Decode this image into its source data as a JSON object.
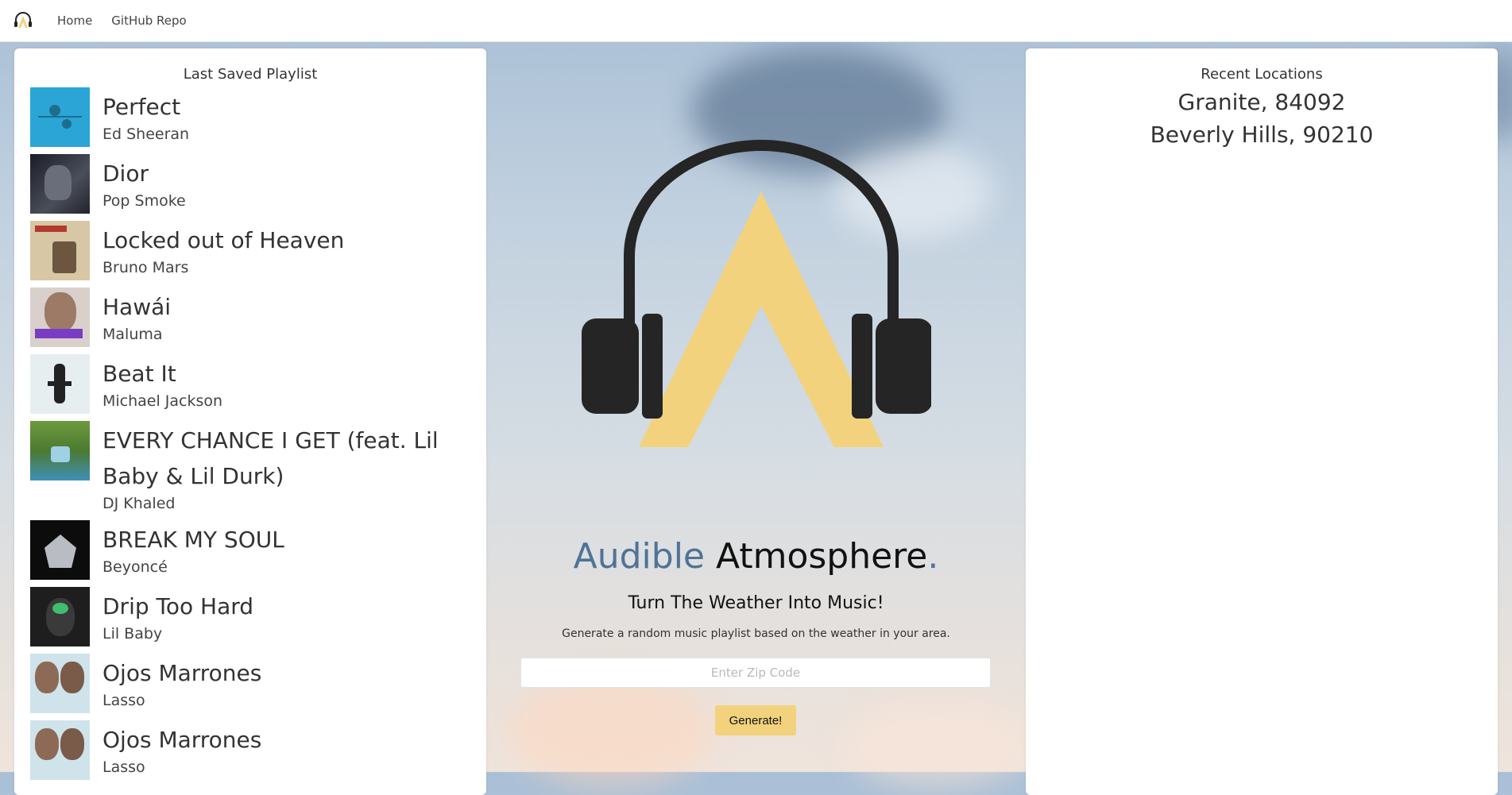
{
  "nav": {
    "logo_icon": "headphones-logo-icon",
    "links": [
      "Home",
      "GitHub Repo"
    ]
  },
  "playlist": {
    "title": "Last Saved Playlist",
    "songs": [
      {
        "title": "Perfect",
        "artist": "Ed Sheeran"
      },
      {
        "title": "Dior",
        "artist": "Pop Smoke"
      },
      {
        "title": "Locked out of Heaven",
        "artist": "Bruno Mars"
      },
      {
        "title": "Hawái",
        "artist": "Maluma"
      },
      {
        "title": "Beat It",
        "artist": "Michael Jackson"
      },
      {
        "title": "EVERY CHANCE I GET (feat. Lil Baby & Lil Durk)",
        "artist": "DJ Khaled"
      },
      {
        "title": "BREAK MY SOUL",
        "artist": "Beyoncé"
      },
      {
        "title": "Drip Too Hard",
        "artist": "Lil Baby"
      },
      {
        "title": "Ojos Marrones",
        "artist": "Lasso"
      },
      {
        "title": "Ojos Marrones",
        "artist": "Lasso"
      }
    ]
  },
  "hero": {
    "title_part1": "Audible",
    "title_part2": "Atmosphere",
    "title_part3": ".",
    "subtitle": "Turn The Weather Into Music!",
    "description": "Generate a random music playlist based on the weather in your area.",
    "zip_placeholder": "Enter Zip Code",
    "button_label": "Generate!"
  },
  "locations": {
    "title": "Recent Locations",
    "items": [
      "Granite, 84092",
      "Beverly Hills, 90210"
    ]
  },
  "colors": {
    "accent_blue": "#4f7397",
    "logo_yellow": "#f2d27c",
    "headphone_dark": "#252525"
  }
}
